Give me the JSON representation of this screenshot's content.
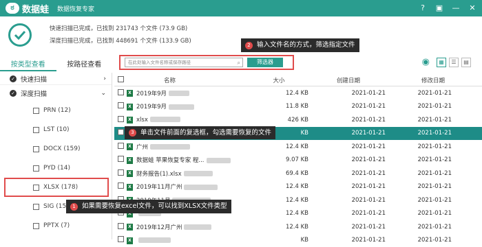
{
  "app": {
    "name": "数据蛙",
    "subtitle": "数据恢复专家",
    "logo_icon": "frog-logo",
    "window_controls": [
      "help-icon",
      "save-icon",
      "minimize-icon",
      "close-icon"
    ]
  },
  "summary": {
    "quick_scan": "快速扫描已完成，已找到 231743 个文件 (73.9 GB)",
    "deep_scan": "深度扫描已完成，已找到 448691 个文件 (133.9 GB)"
  },
  "tabs": [
    "按类型查看",
    "按路径查看"
  ],
  "sidebar": {
    "groups": [
      {
        "label": "快速扫描",
        "chevron": "›"
      },
      {
        "label": "深度扫描",
        "chevron": "⌄"
      }
    ],
    "types": [
      {
        "label": "PRN (12)"
      },
      {
        "label": "LST (10)"
      },
      {
        "label": "DOCX (159)"
      },
      {
        "label": "PYD (14)"
      },
      {
        "label": "XLSX (178)"
      },
      {
        "label": "SIG (15)"
      },
      {
        "label": "PPTX (7)"
      }
    ]
  },
  "filter": {
    "placeholder": "在此处输入文件名称或保存路径",
    "button": "筛选器"
  },
  "tooltips": {
    "t1": {
      "badge": "1",
      "text": "如果需要恢复excel文件，可以找到XLSX文件类型"
    },
    "t2": {
      "badge": "2",
      "text": "输入文件名的方式，筛选指定文件"
    },
    "t3": {
      "badge": "3",
      "text": "单击文件前面的复选框，勾选需要恢复的文件"
    }
  },
  "table": {
    "headers": {
      "name": "名称",
      "size": "大小",
      "created": "创建日期",
      "modified": "修改日期"
    },
    "rows": [
      {
        "name": "2019年9月",
        "size": "12.4 KB",
        "created": "2021-01-21",
        "modified": "2021-01-21"
      },
      {
        "name": "2019年9月",
        "size": "11.8 KB",
        "created": "2021-01-21",
        "modified": "2021-01-21"
      },
      {
        "name": "xlsx",
        "size": "426 KB",
        "created": "2021-01-21",
        "modified": "2021-01-21"
      },
      {
        "name": "",
        "size": "KB",
        "created": "2021-01-21",
        "modified": "2021-01-21"
      },
      {
        "name": "广州",
        "size": "12.4 KB",
        "created": "2021-01-21",
        "modified": "2021-01-21"
      },
      {
        "name": "数据蛙 苹果恢复专家 程...",
        "size": "9.07 KB",
        "created": "2021-01-21",
        "modified": "2021-01-21"
      },
      {
        "name": "财务报告(1).xlsx",
        "size": "69.4 KB",
        "created": "2021-01-21",
        "modified": "2021-01-21"
      },
      {
        "name": "2019年11月广州",
        "size": "12.4 KB",
        "created": "2021-01-21",
        "modified": "2021-01-21"
      },
      {
        "name": "2019年11月",
        "size": "12.4 KB",
        "created": "2021-01-21",
        "modified": "2021-01-21"
      },
      {
        "name": "",
        "size": "12.4 KB",
        "created": "2021-01-21",
        "modified": "2021-01-21"
      },
      {
        "name": "2019年12月广州",
        "size": "12.4 KB",
        "created": "2021-01-21",
        "modified": "2021-01-21"
      },
      {
        "name": "",
        "size": "KB",
        "created": "2021-01-21",
        "modified": "2021-01-21"
      }
    ]
  },
  "colors": {
    "accent": "#2a9d8f",
    "highlight": "#e04b4b"
  }
}
